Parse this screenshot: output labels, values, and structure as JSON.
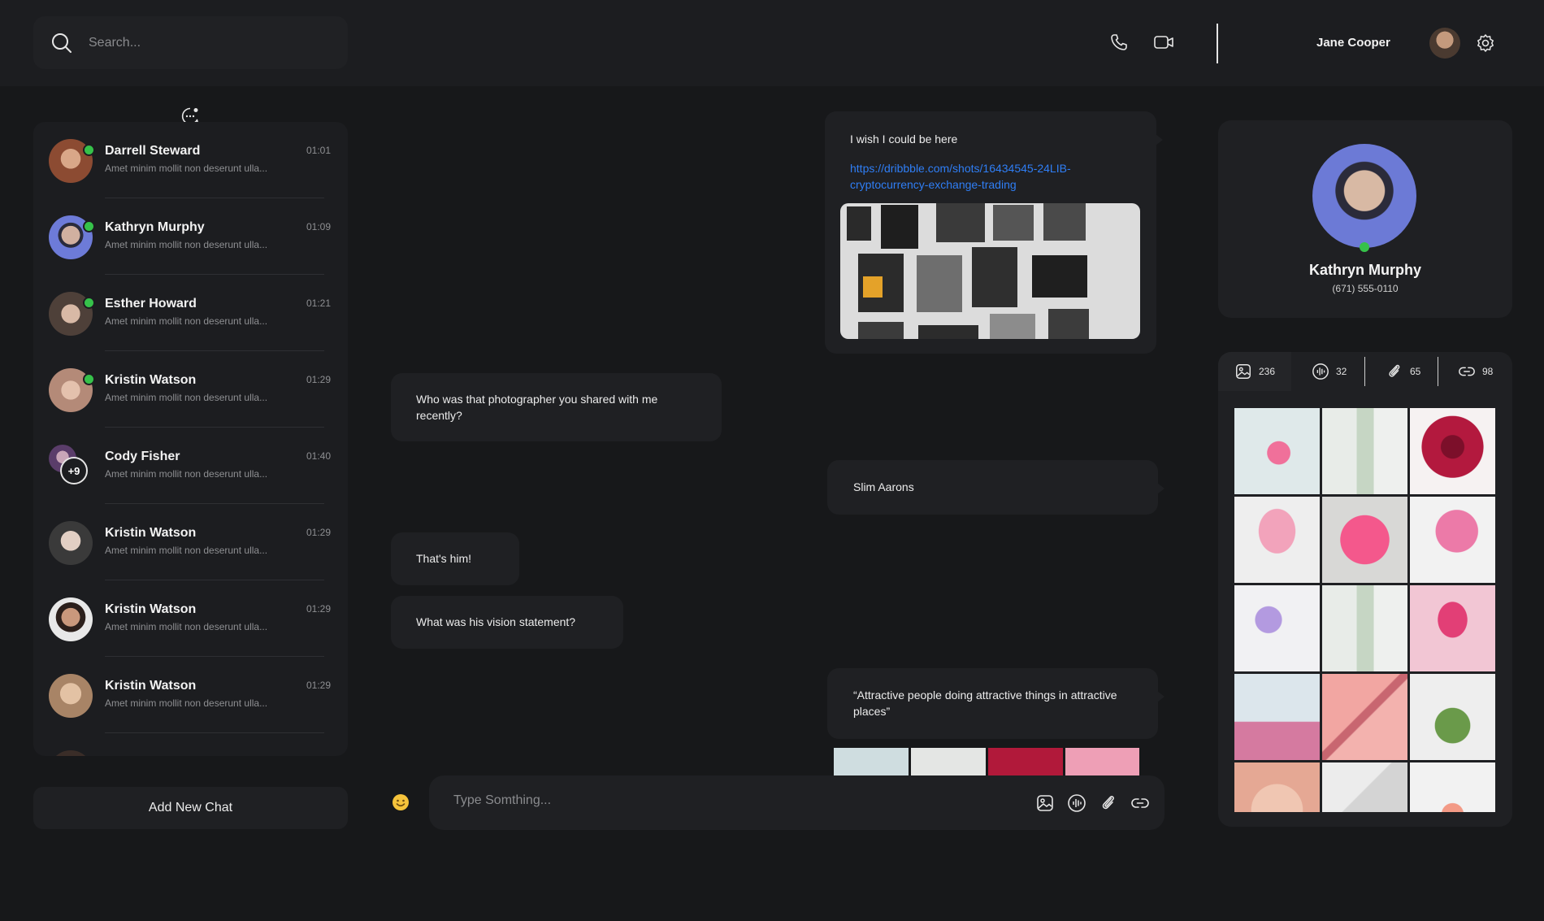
{
  "header": {
    "search_placeholder": "Search...",
    "user_name": "Jane Cooper",
    "icons": [
      "search-icon",
      "phone-icon",
      "video-icon",
      "gear-icon"
    ]
  },
  "sidebar": {
    "chats": [
      {
        "name": "Darrell Steward",
        "preview": "Amet minim mollit non deserunt ulla...",
        "time": "01:01",
        "online": true
      },
      {
        "name": "Kathryn Murphy",
        "preview": "Amet minim mollit non deserunt ulla...",
        "time": "01:09",
        "online": true
      },
      {
        "name": "Esther Howard",
        "preview": "Amet minim mollit non deserunt ulla...",
        "time": "01:21",
        "online": true
      },
      {
        "name": "Kristin Watson",
        "preview": "Amet minim mollit non deserunt ulla...",
        "time": "01:29",
        "online": true
      },
      {
        "name": "Cody Fisher",
        "preview": "Amet minim mollit non deserunt ulla...",
        "time": "01:40",
        "group_badge": "+9"
      },
      {
        "name": "Kristin Watson",
        "preview": "Amet minim mollit non deserunt ulla...",
        "time": "01:29"
      },
      {
        "name": "Kristin Watson",
        "preview": "Amet minim mollit non deserunt ulla...",
        "time": "01:29"
      },
      {
        "name": "Kristin Watson",
        "preview": "Amet minim mollit non deserunt ulla...",
        "time": "01:29"
      }
    ],
    "add_chat_label": "Add New Chat"
  },
  "messages": {
    "m1_text": "I wish I could be here",
    "m1_link": "https://dribbble.com/shots/16434545-24LIB-cryptocurrency-exchange-trading",
    "m2_text": "Who was that photographer you shared with me recently?",
    "m3_text": "Slim Aarons",
    "m4_text": "That's him!",
    "m5_text": "What was his vision statement?",
    "m6_text": "“Attractive people doing attractive things in attractive places”"
  },
  "composer": {
    "placeholder": "Type Somthing..."
  },
  "profile": {
    "name": "Kathryn Murphy",
    "phone": "(671) 555-0110"
  },
  "media_tabs": [
    {
      "icon": "image-icon",
      "count": "236"
    },
    {
      "icon": "audio-icon",
      "count": "32"
    },
    {
      "icon": "attachment-icon",
      "count": "65"
    },
    {
      "icon": "link-icon",
      "count": "98"
    }
  ],
  "colors": {
    "background": "#17181a",
    "panel": "#1f2023",
    "online": "#36c24a",
    "link": "#2f7ef5"
  }
}
